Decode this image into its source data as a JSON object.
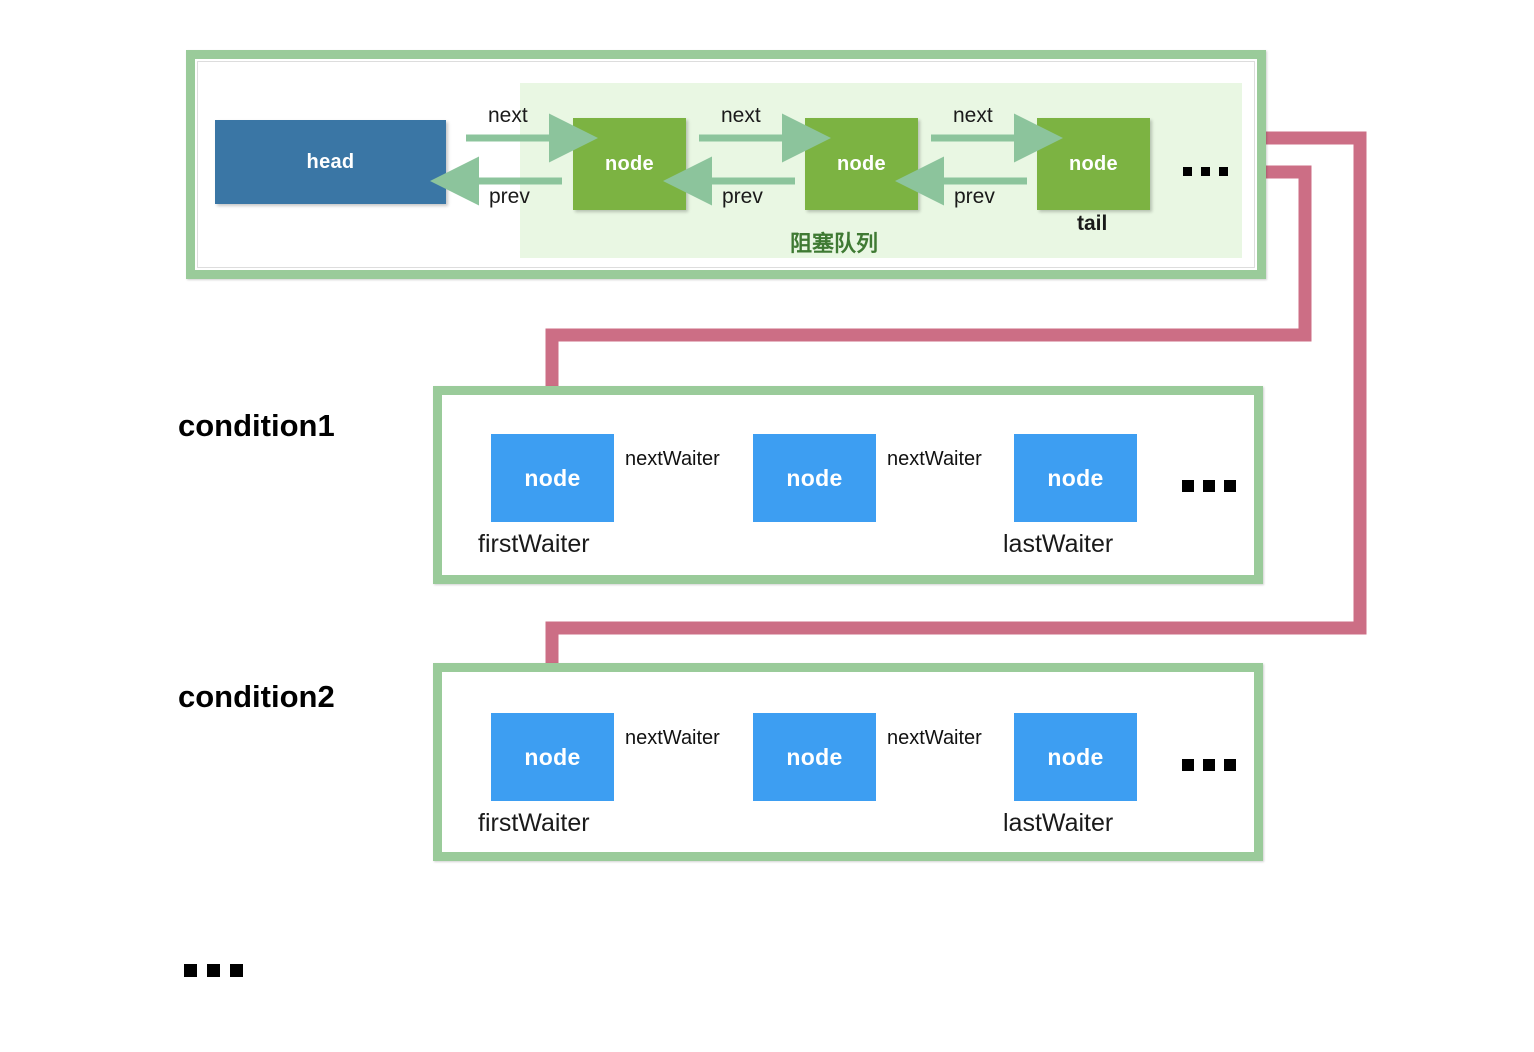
{
  "colors": {
    "panel_border": "#9acb9a",
    "queue_band": "#e9f7e3",
    "head_box": "#3a76a5",
    "green_node": "#7cb342",
    "blue_node": "#3d9ef2",
    "green_arrow": "#8cc49c",
    "pink_link": "#cc6e85",
    "black_arrow": "#000000",
    "cn_label": "#3f7a33"
  },
  "queue_panel": {
    "head_label": "head",
    "node_label": "node",
    "tail_label": "tail",
    "band_caption": "阻塞队列",
    "nodes": [
      {
        "label": "node"
      },
      {
        "label": "node"
      },
      {
        "label": "node"
      }
    ],
    "links": [
      {
        "next": "next",
        "prev": "prev"
      },
      {
        "next": "next",
        "prev": "prev"
      },
      {
        "next": "next",
        "prev": "prev"
      }
    ],
    "ellipsis": "..."
  },
  "conditions": [
    {
      "title": "condition1",
      "nodes": [
        {
          "label": "node",
          "caption": "firstWaiter"
        },
        {
          "label": "node",
          "caption": ""
        },
        {
          "label": "node",
          "caption": "lastWaiter"
        }
      ],
      "link_labels": [
        "nextWaiter",
        "nextWaiter"
      ],
      "ellipsis": "..."
    },
    {
      "title": "condition2",
      "nodes": [
        {
          "label": "node",
          "caption": "firstWaiter"
        },
        {
          "label": "node",
          "caption": ""
        },
        {
          "label": "node",
          "caption": "lastWaiter"
        }
      ],
      "link_labels": [
        "nextWaiter",
        "nextWaiter"
      ],
      "ellipsis": "..."
    }
  ],
  "more_conditions_ellipsis": "..."
}
